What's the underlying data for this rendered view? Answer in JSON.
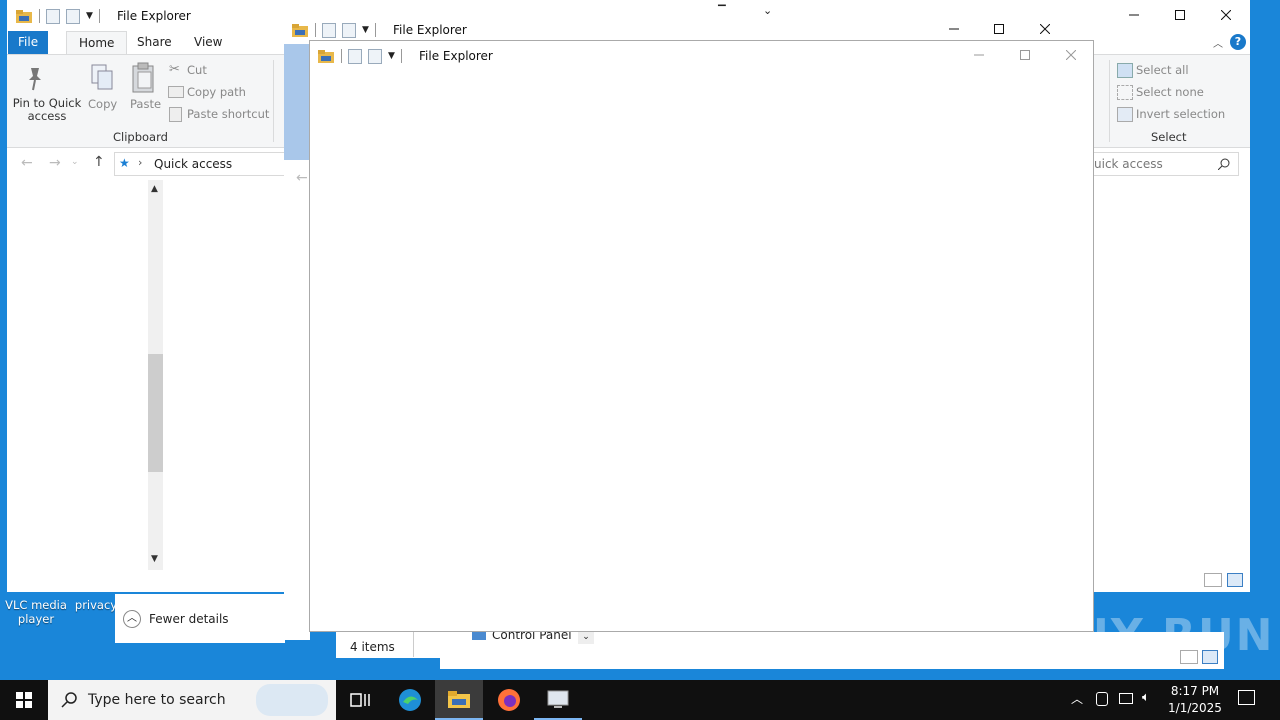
{
  "colors": {
    "desktop": "#1a86d9",
    "accent": "#1979ca",
    "taskbar": "#101010"
  },
  "window_back": {
    "title": "File Explorer",
    "tabs": {
      "file": "File",
      "home": "Home",
      "share": "Share",
      "view": "View"
    },
    "clipboard": {
      "pin": "Pin to Quick access",
      "copy": "Copy",
      "paste": "Paste",
      "cut": "Cut",
      "copy_path": "Copy path",
      "paste_shortcut": "Paste shortcut",
      "group": "Clipboard"
    },
    "select": {
      "select_all": "Select all",
      "select_none": "Select none",
      "invert": "Invert selection",
      "group": "Select"
    },
    "address": "Quick access",
    "search_placeholder": "uick access",
    "fewer_details": "Fewer details"
  },
  "window_mid": {
    "title": "File Explorer",
    "status_items": "4 items",
    "control_panel": "Control Panel"
  },
  "window_front": {
    "title": "File Explorer"
  },
  "desktop_icons": {
    "vlc": "VLC media player",
    "privacy": "privacy"
  },
  "taskbar": {
    "search_placeholder": "Type here to search",
    "time": "8:17 PM",
    "date": "1/1/2025"
  },
  "watermark": "ANY RUN"
}
